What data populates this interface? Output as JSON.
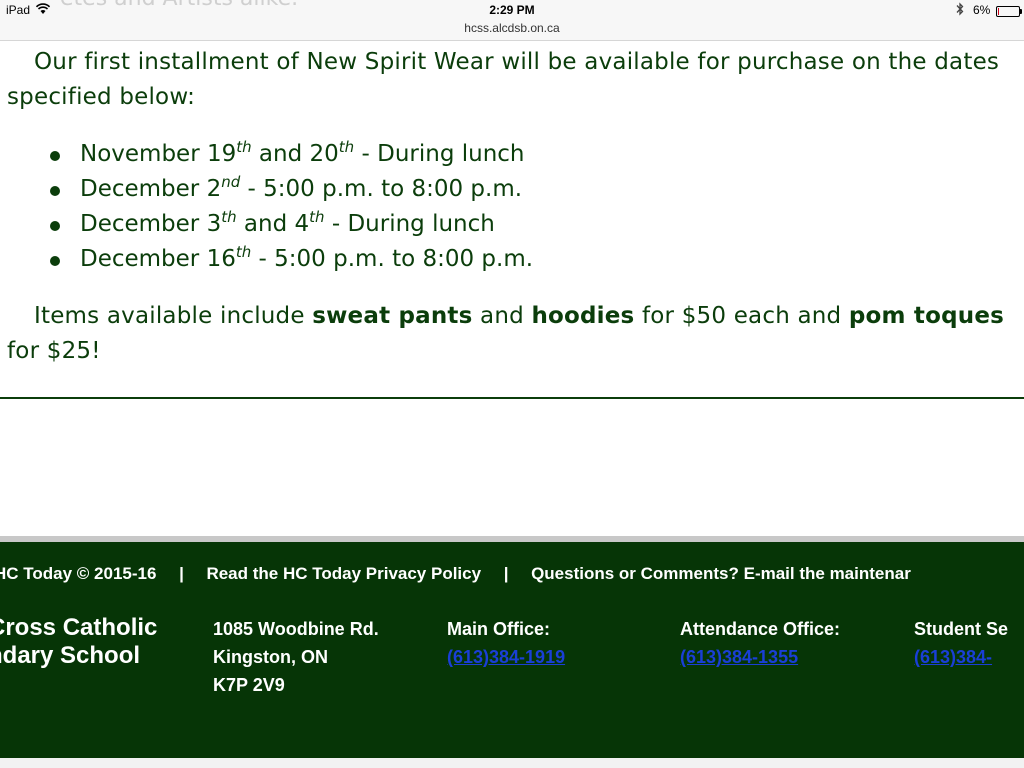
{
  "status_bar": {
    "device": "iPad",
    "time": "2:29 PM",
    "url": "hcss.alcdsb.on.ca",
    "battery_percent": "6%",
    "battery_level": 0.06,
    "icons": [
      "wifi-icon",
      "bluetooth-icon",
      "battery-icon"
    ]
  },
  "partial_heading_text": "etes and Artists alike.",
  "article": {
    "intro": "Our first installment of New Spirit Wear will be available for purchase on the dates specified below:",
    "dates": [
      {
        "pre": "November 19",
        "sup1": "th",
        "mid": " and 20",
        "sup2": "th",
        "post": " - During lunch"
      },
      {
        "pre": "December 2",
        "sup1": "nd",
        "mid": "",
        "sup2": "",
        "post": " - 5:00 p.m. to 8:00 p.m."
      },
      {
        "pre": "December 3",
        "sup1": "th",
        "mid": " and 4",
        "sup2": "th",
        "post": " - During lunch"
      },
      {
        "pre": "December 16",
        "sup1": "th",
        "mid": "",
        "sup2": "",
        "post": " - 5:00 p.m. to 8:00 p.m."
      }
    ],
    "items_text": {
      "t1": "Items available include ",
      "b1": "sweat pants",
      "t2": " and ",
      "b2": "hoodies",
      "t3": " for $50 each and ",
      "b3": "pom toques",
      "t4": " for $25!"
    }
  },
  "footer": {
    "copyright": "HC Today © 2015-16",
    "privacy_link": "Read the HC Today Privacy Policy",
    "contact_text": "Questions or Comments? E-mail the maintenar",
    "separator": "|",
    "school_line1": "Cross Catholic",
    "school_line2": "ndary School",
    "address": [
      "1085 Woodbine Rd.",
      "Kingston, ON",
      "K7P 2V9"
    ],
    "main_office_label": "Main Office:",
    "main_office_phone": "(613)384-1919",
    "attendance_label": "Attendance Office:",
    "attendance_phone": "(613)384-1355",
    "student_label": "Student Se",
    "student_phone": "(613)384-"
  },
  "colors": {
    "text_green": "#0b3d0b",
    "footer_bg": "#063506",
    "link_blue": "#1a3fd6"
  }
}
